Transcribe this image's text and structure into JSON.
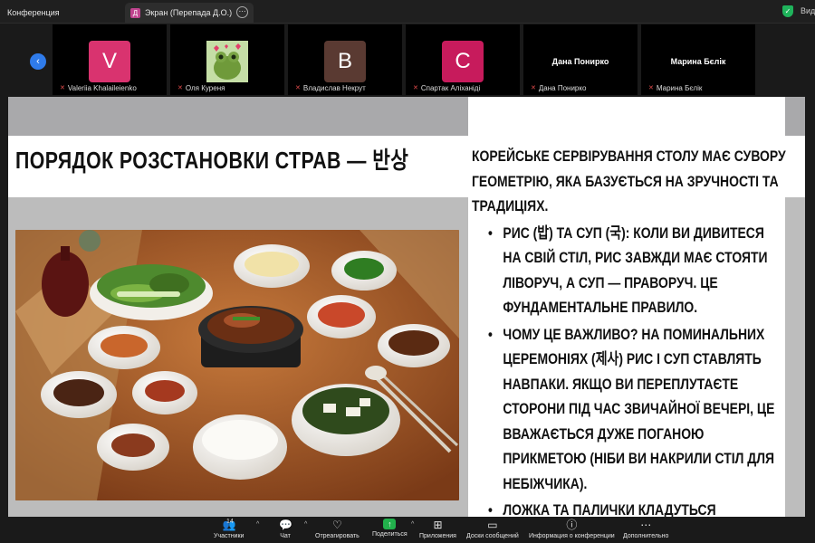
{
  "tabs": [
    {
      "label": "Конференция"
    },
    {
      "label": "Экран (Перепада Д.О.)",
      "icon": "Д"
    }
  ],
  "topbar_right": "Вид",
  "participants": [
    {
      "name": "Valeriia Khalaileienko",
      "avatar": "V",
      "color": "#d9336f"
    },
    {
      "name": "Оля Куреня",
      "avatar": "",
      "color": "#cfe3b2"
    },
    {
      "name": "Владислав Некрут",
      "avatar": "В",
      "color": "#5a3a32"
    },
    {
      "name": "Спартак Аліханіді",
      "avatar": "С",
      "color": "#c71b5c"
    },
    {
      "name": "Дана Понирко",
      "avatar": ""
    },
    {
      "name": "Марина Бєлік",
      "avatar": ""
    }
  ],
  "slide": {
    "title": "ПОРЯДОК РОЗСТАНОВКИ СТРАВ — 반상",
    "intro": "КОРЕЙСЬКЕ СЕРВІРУВАННЯ СТОЛУ МАЄ СУВОРУ ГЕОМЕТРІЮ, ЯКА БАЗУЄТЬСЯ НА ЗРУЧНОСТІ ТА ТРАДИЦІЯХ.",
    "bullets": [
      "РИС (밥) ТА СУП (국): КОЛИ ВИ ДИВИТЕСЯ НА СВІЙ СТІЛ, РИС ЗАВЖДИ МАЄ СТОЯТИ ЛІВОРУЧ, А СУП — ПРАВОРУЧ. ЦЕ ФУНДАМЕНТАЛЬНЕ ПРАВИЛО.",
      "ЧОМУ ЦЕ ВАЖЛИВО? НА ПОМИНАЛЬНИХ ЦЕРЕМОНІЯХ (제사) РИС І СУП СТАВЛЯТЬ НАВПАКИ. ЯКЩО ВИ ПЕРЕПЛУТАЄТЕ СТОРОНИ ПІД ЧАС ЗВИЧАЙНОЇ ВЕЧЕРІ, ЦЕ ВВАЖАЄТЬСЯ ДУЖЕ ПОГАНОЮ ПРИКМЕТОЮ (НІБИ ВИ НАКРИЛИ СТІЛ ДЛЯ НЕБІЖЧИКА).",
      "ЛОЖКА ТА ПАЛИЧКИ КЛАДУТЬСЯ ПРАВОРУЧ ВІД СУПУ."
    ]
  },
  "toolbar": {
    "participants_label": "Участники",
    "participants_count": "14",
    "chat_label": "Чат",
    "react_label": "Отреагировать",
    "share_label": "Поделиться",
    "apps_label": "Приложения",
    "whiteboard_label": "Доски сообщений",
    "info_label": "Информация о конференции",
    "more_label": "Дополнительно"
  }
}
